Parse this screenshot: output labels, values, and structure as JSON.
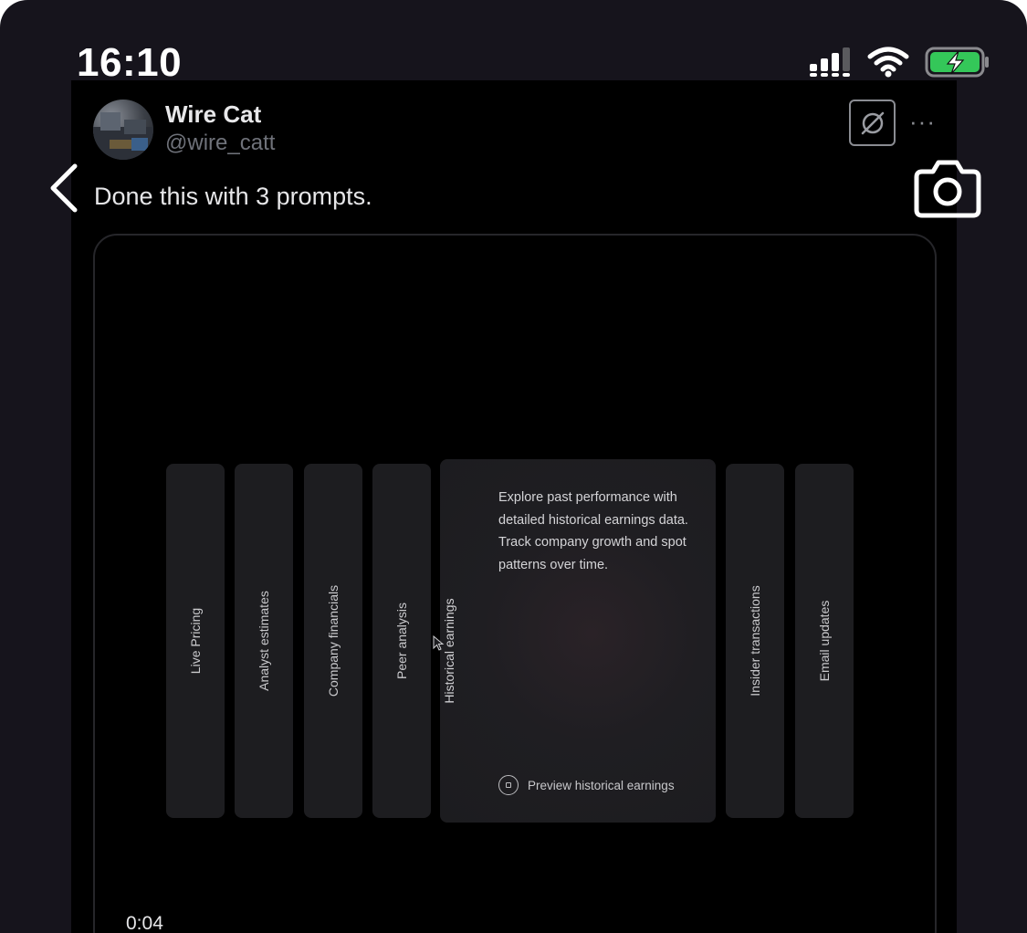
{
  "status_bar": {
    "time": "16:10"
  },
  "post": {
    "author_name": "Wire Cat",
    "author_handle": "@wire_catt",
    "text": "Done this with 3 prompts.",
    "more": "···"
  },
  "video": {
    "timestamp": "0:04",
    "cards_left": [
      "Live Pricing",
      "Analyst estimates",
      "Company financials",
      "Peer analysis"
    ],
    "expanded_card": {
      "title": "Historical earnings",
      "description": "Explore past performance with detailed historical earnings data. Track company growth and spot patterns over time.",
      "preview_label": "Preview historical earnings"
    },
    "cards_right": [
      "Insider transactions",
      "Email updates"
    ]
  },
  "icons": {
    "back": "chevron-left-icon",
    "camera": "camera-icon",
    "grok": "grok-icon",
    "signal": "signal-icon",
    "wifi": "wifi-icon",
    "battery": "battery-charging-icon"
  },
  "colors": {
    "background": "#16141c",
    "panel": "#000000",
    "card": "#1d1d20",
    "battery_fill": "#34c759"
  }
}
